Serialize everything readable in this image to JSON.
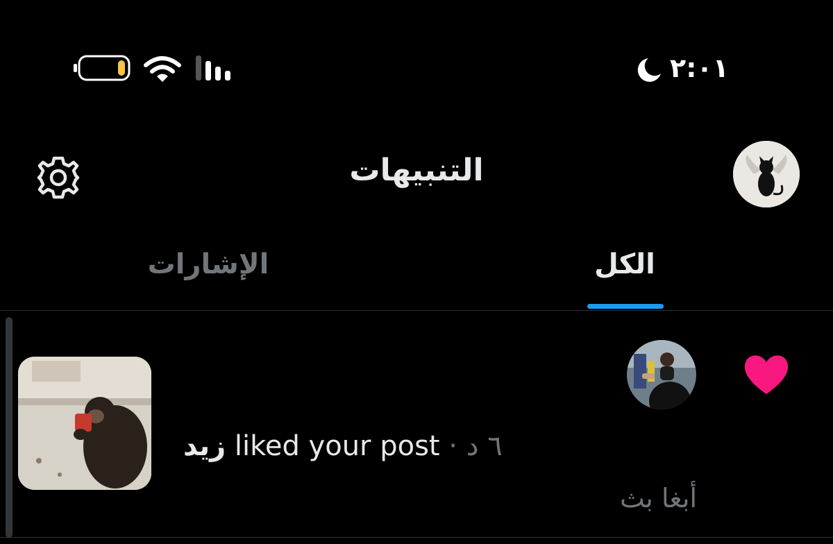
{
  "status_bar": {
    "time": "٢:٠١",
    "icons": [
      "moon-icon",
      "battery-icon",
      "wifi-icon",
      "signal-icon"
    ]
  },
  "header": {
    "title": "التنبيهات",
    "settings_icon": "gear-icon",
    "avatar": "profile-avatar"
  },
  "tabs": [
    {
      "label": "الكل",
      "selected": true
    },
    {
      "label": "الإشارات",
      "selected": false
    }
  ],
  "notification": {
    "icon": "heart-icon",
    "actor_name": "زيد",
    "action_text": " liked your post",
    "separator": " · ",
    "time": "٦ د",
    "preview_text": "أبغا بث"
  },
  "colors": {
    "background": "#000000",
    "accent": "#1d9bf0",
    "heart": "#f91880",
    "secondary_text": "#71767b"
  }
}
